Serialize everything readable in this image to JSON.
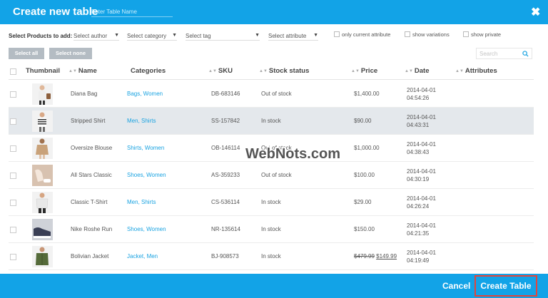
{
  "header": {
    "title": "Create new table",
    "name_placeholder": "Enter Table Name",
    "close_glyph": "✖"
  },
  "filters": {
    "label": "Select Products to add:",
    "author": "Select author",
    "category": "Select category",
    "tag": "Select tag",
    "attribute": "Select attribute",
    "dropdown_arrow": "▼",
    "only_current": "only current attribute",
    "show_variations": "show variations",
    "show_private": "show private"
  },
  "actions": {
    "select_all": "Select all",
    "select_none": "Select none",
    "search_placeholder": "Search"
  },
  "columns": {
    "thumbnail": "Thumbnail",
    "name": "Name",
    "categories": "Categories",
    "sku": "SKU",
    "stock": "Stock status",
    "price": "Price",
    "date": "Date",
    "attributes": "Attributes",
    "sort_glyph": "▲▼"
  },
  "products": [
    {
      "name": "Diana Bag",
      "categories": "Bags, Women",
      "sku": "DB-683146",
      "stock": "Out of stock",
      "price": "$1,400.00",
      "price_sale": "",
      "date": "2014-04-01",
      "time": "04:54:26",
      "thumb_color": "#8b5e3c"
    },
    {
      "name": "Stripped Shirt",
      "categories": "Men, Shirts",
      "sku": "SS-157842",
      "stock": "In stock",
      "price": "$90.00",
      "price_sale": "",
      "date": "2014-04-01",
      "time": "04:43:31",
      "thumb_color": "#333333"
    },
    {
      "name": "Oversize Blouse",
      "categories": "Shirts, Women",
      "sku": "OB-146114",
      "stock": "Out of stock",
      "price": "$1,000.00",
      "price_sale": "",
      "date": "2014-04-01",
      "time": "04:38:43",
      "thumb_color": "#c9a27a"
    },
    {
      "name": "All Stars Classic",
      "categories": "Shoes, Women",
      "sku": "AS-359233",
      "stock": "Out of stock",
      "price": "$100.00",
      "price_sale": "",
      "date": "2014-04-01",
      "time": "04:30:19",
      "thumb_color": "#d8c2b0"
    },
    {
      "name": "Classic T-Shirt",
      "categories": "Men, Shirts",
      "sku": "CS-536114",
      "stock": "In stock",
      "price": "$29.00",
      "price_sale": "",
      "date": "2014-04-01",
      "time": "04:26:24",
      "thumb_color": "#e8e8e8"
    },
    {
      "name": "Nike Roshe Run",
      "categories": "Shoes, Women",
      "sku": "NR-135614",
      "stock": "In stock",
      "price": "$150.00",
      "price_sale": "",
      "date": "2014-04-01",
      "time": "04:21:35",
      "thumb_color": "#3a3f55"
    },
    {
      "name": "Bolivian Jacket",
      "categories": "Jacket, Men",
      "sku": "BJ-908573",
      "stock": "In stock",
      "price": "$479.99",
      "price_sale": "$149.99",
      "date": "2014-04-01",
      "time": "04:19:49",
      "thumb_color": "#556b3a"
    }
  ],
  "footer": {
    "cancel": "Cancel",
    "create": "Create Table"
  },
  "colors": {
    "accent": "#12a3e7",
    "link": "#1aa3e1",
    "highlight": "#e2453c"
  },
  "watermark": "WebNots.com"
}
